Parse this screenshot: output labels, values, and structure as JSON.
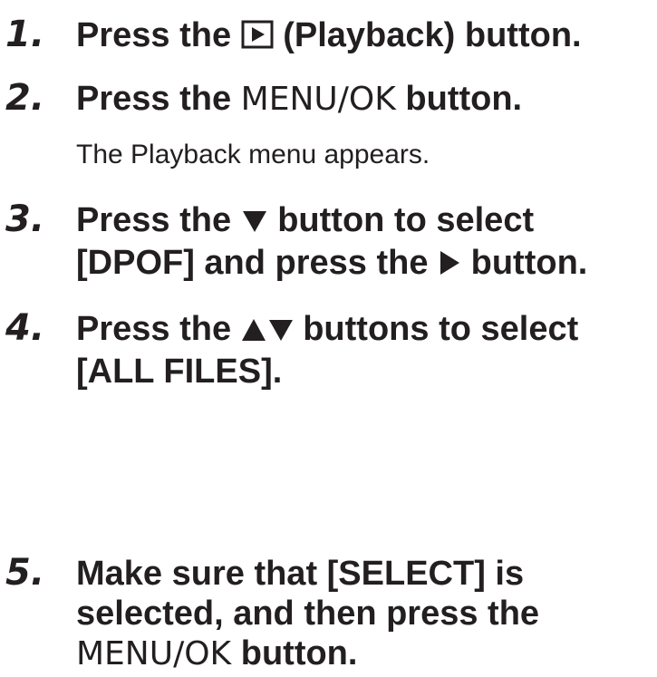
{
  "steps": [
    {
      "number": "1.",
      "before": "Press the",
      "after": "(Playback) button.",
      "icon": "playback-icon"
    },
    {
      "number": "2.",
      "before": "Press the",
      "key": "MENU/OK",
      "after": "button.",
      "note": "The Playback menu appears."
    },
    {
      "number": "3.",
      "before": "Press the",
      "after": "button to select",
      "icon": "down-triangle-icon",
      "line2_before": "[DPOF] and press the",
      "line2_after": "button.",
      "line2_icon": "right-triangle-icon"
    },
    {
      "number": "4.",
      "before": "Press the",
      "after": "buttons to select",
      "icon": "up-down-triangle-icon",
      "line2": "[ALL FILES]."
    },
    {
      "number": "5.",
      "line1": "Make sure that [SELECT] is",
      "line2": "selected, and then press the",
      "key": "MENU/OK",
      "after": "button."
    }
  ]
}
